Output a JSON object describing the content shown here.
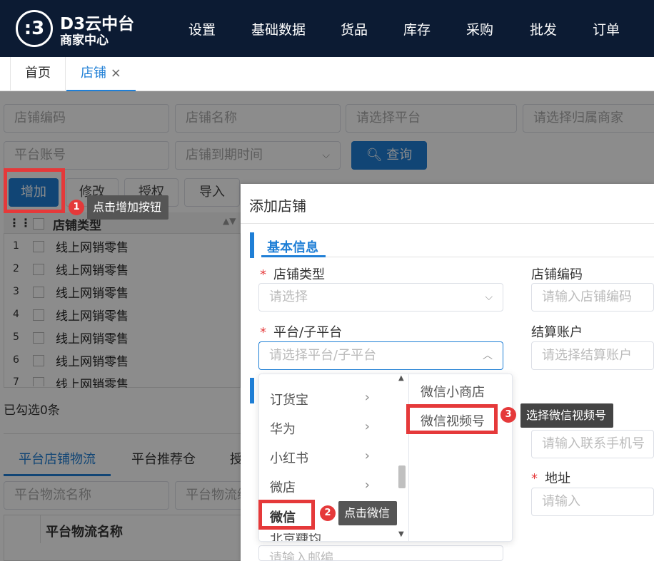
{
  "header": {
    "logo_mark": ":3",
    "logo_title": "D3云中台",
    "logo_subtitle": "商家中心",
    "nav": [
      "设置",
      "基础数据",
      "货品",
      "库存",
      "采购",
      "批发",
      "订单"
    ]
  },
  "tabs": {
    "home": "首页",
    "shop": "店铺",
    "close": "×"
  },
  "filters": {
    "shop_code": "店铺编码",
    "shop_name": "店铺名称",
    "platform": "请选择平台",
    "merchant": "请选择归属商家",
    "account": "平台账号",
    "expire": "店铺到期时间",
    "query": "查询"
  },
  "toolbar": {
    "add": "增加",
    "edit": "修改",
    "auth": "授权",
    "import": "导入"
  },
  "table": {
    "header_type": "店铺类型",
    "rows": [
      {
        "num": "1",
        "type": "线上网销零售"
      },
      {
        "num": "2",
        "type": "线上网销零售"
      },
      {
        "num": "3",
        "type": "线上网销零售"
      },
      {
        "num": "4",
        "type": "线上网销零售"
      },
      {
        "num": "5",
        "type": "线上网销零售"
      },
      {
        "num": "6",
        "type": "线上网销零售"
      },
      {
        "num": "7",
        "type": "线上网销零售"
      }
    ],
    "selected_count": "已勾选0条"
  },
  "bottom": {
    "tabs": [
      "平台店铺物流",
      "平台推荐仓",
      "授"
    ],
    "logistics_name": "平台物流名称",
    "logistics_code": "平台物流编",
    "col_header": "平台物流名称"
  },
  "dialog": {
    "title": "添加店铺",
    "section": "基本信息",
    "shop_type_label": "店铺类型",
    "shop_type_placeholder": "请选择",
    "shop_code_label": "店铺编码",
    "shop_code_placeholder": "请输入店铺编码",
    "platform_label": "平台/子平台",
    "platform_placeholder": "请选择平台/子平台",
    "settle_label": "结算账户",
    "settle_placeholder": "请选择结算账户",
    "phone_placeholder": "请输入联系手机号",
    "address_label": "地址",
    "address_placeholder": "请输入",
    "email_placeholder": "请输入邮编"
  },
  "dropdown": {
    "level1": [
      "订货宝",
      "华为",
      "小红书",
      "微店",
      "微信",
      "北京糖均"
    ],
    "level2": [
      "微信小商店",
      "微信视频号"
    ]
  },
  "annotations": [
    {
      "num": "1",
      "text": "点击增加按钮"
    },
    {
      "num": "2",
      "text": "点击微信"
    },
    {
      "num": "3",
      "text": "选择微信视频号"
    }
  ]
}
